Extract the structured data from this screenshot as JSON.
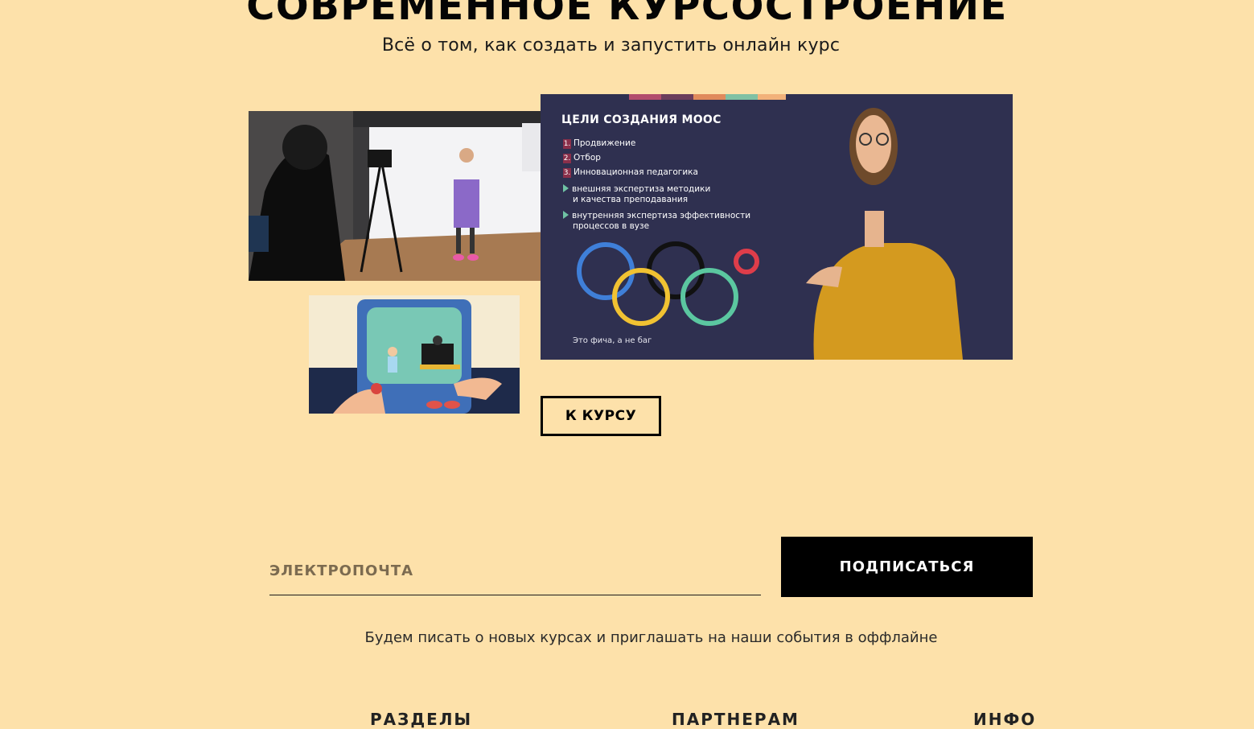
{
  "course": {
    "title": "СОВРЕМЕННОЕ КУРСОСТРОЕНИЕ",
    "subtitle": "Всё о том, как создать и запустить онлайн курс",
    "button_label": "К КУРСУ"
  },
  "slide": {
    "title": "ЦЕЛИ СОЗДАНИЯ MOOC",
    "numbered_items": [
      {
        "num": "1.",
        "text": "Продвижение"
      },
      {
        "num": "2.",
        "text": "Отбор"
      },
      {
        "num": "3.",
        "text": "Инновационная педагогика"
      }
    ],
    "bullets": [
      {
        "line1": "внешняя экспертиза методики",
        "line2": "и качества преподавания"
      },
      {
        "line1": "внутренняя экспертиза эффективности",
        "line2": "процессов в вузе"
      }
    ],
    "caption": "Это фича, а не баг"
  },
  "subscribe": {
    "email_placeholder": "ЭЛЕКТРОПОЧТА",
    "email_value": "",
    "button_label": "ПОДПИСАТЬСЯ",
    "note": "Будем писать о новых курсах и приглашать на наши события в оффлайне"
  },
  "footer": {
    "headings": [
      "РАЗДЕЛЫ",
      "ПАРТНЕРАМ",
      "ИНФО"
    ]
  },
  "colors": {
    "page_background": "#fde1aa",
    "button_dark": "#000000",
    "slide_background": "#2e2f4f"
  }
}
